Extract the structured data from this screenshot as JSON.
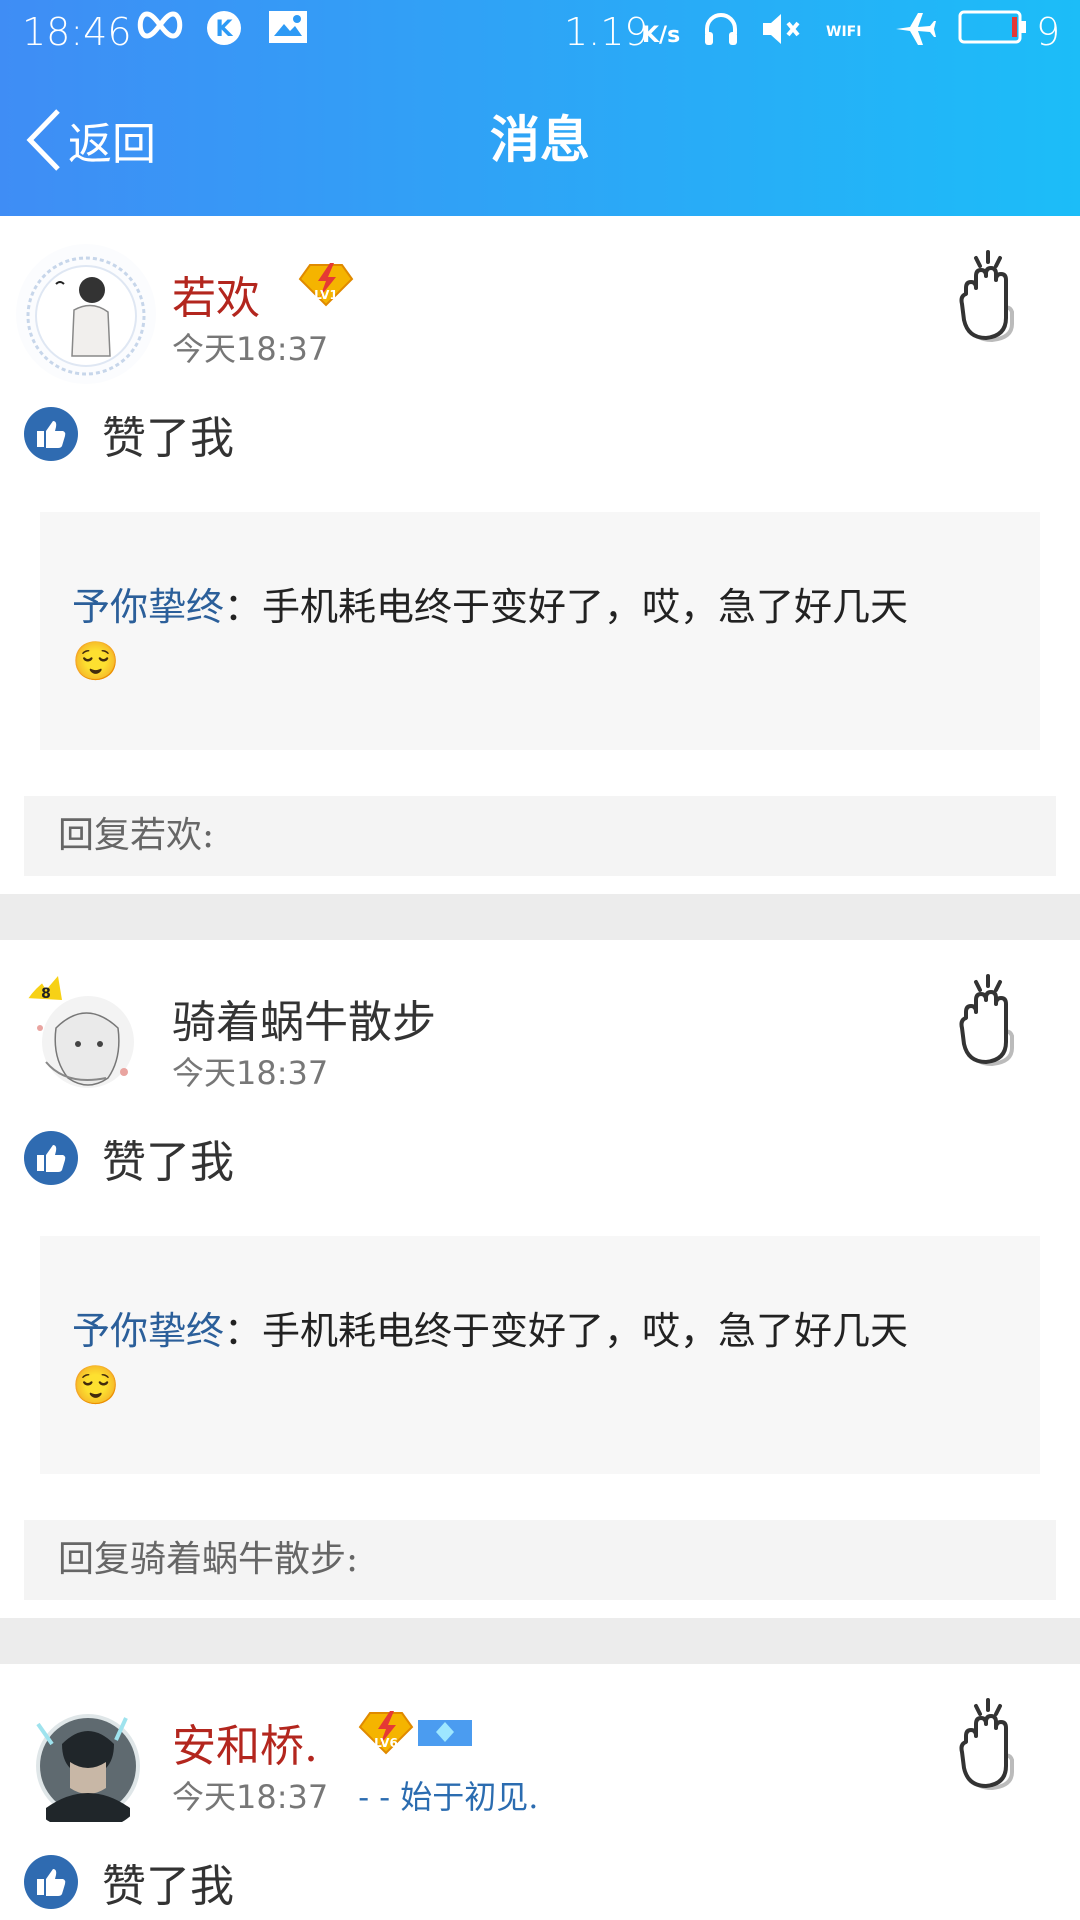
{
  "status_bar": {
    "time": "18:46",
    "net_speed": "1.19",
    "net_unit": "K/s",
    "wifi_label": "WIFI",
    "battery_level": "9"
  },
  "nav": {
    "back_label": "返回",
    "title": "消息"
  },
  "messages": [
    {
      "name": "若欢",
      "name_color": "#b3261e",
      "level": "LV1",
      "time": "今天18:37",
      "signature": "",
      "action": "赞了我",
      "quote_user": "予你挚终",
      "quote_sep": "：",
      "quote_text": "手机耗电终于变好了，哎，急了好几天",
      "quote_emoji": "😌",
      "reply_placeholder": "回复若欢:"
    },
    {
      "name": "骑着蜗牛散步",
      "name_color": "#333333",
      "level": "",
      "time": "今天18:37",
      "signature": "",
      "action": "赞了我",
      "quote_user": "予你挚终",
      "quote_sep": "：",
      "quote_text": "手机耗电终于变好了，哎，急了好几天",
      "quote_emoji": "😌",
      "reply_placeholder": "回复骑着蜗牛散步:"
    },
    {
      "name": "安和桥.",
      "name_color": "#b3261e",
      "level": "LV6",
      "time": "今天18:37",
      "signature": "- - 始于初见.",
      "action": "赞了我"
    }
  ],
  "colors": {
    "header_start": "#3f8df5",
    "header_end": "#1cbdf8",
    "like_blue": "#2f6bb1",
    "separator": "#ececec"
  },
  "icons": {
    "back": "chevron-left-icon",
    "like": "thumbs-up-icon",
    "clap": "clap-hand-icon",
    "level": "lightning-badge-icon"
  }
}
